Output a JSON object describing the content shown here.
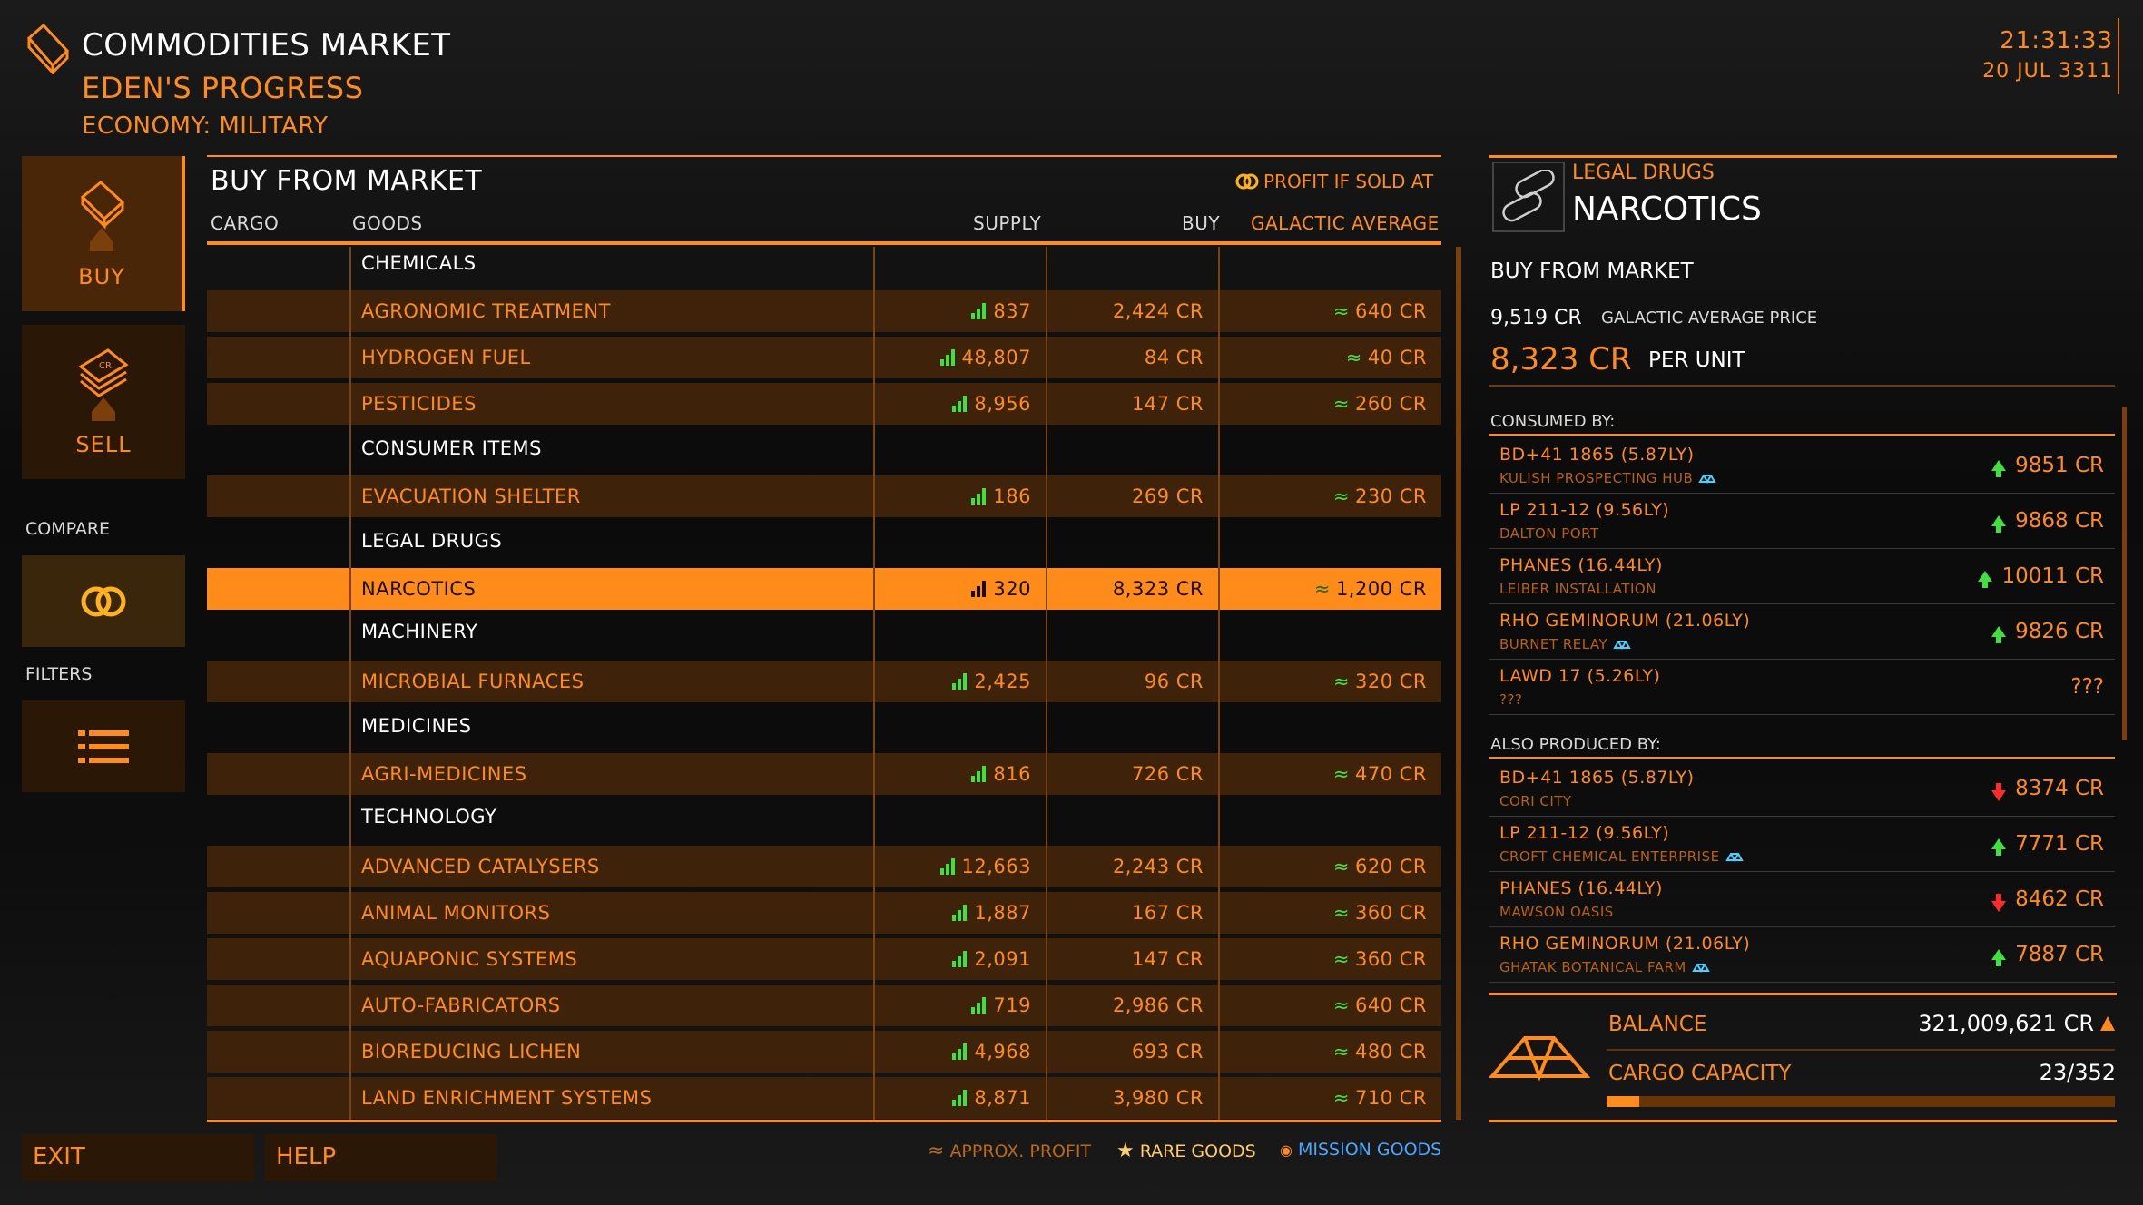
{
  "header": {
    "title": "COMMODITIES MARKET",
    "station": "EDEN'S PROGRESS",
    "economy": "ECONOMY: MILITARY",
    "time": "21:31:33",
    "date": "20 JUL 3311"
  },
  "nav": {
    "buy": "BUY",
    "sell": "SELL",
    "compare": "COMPARE",
    "filters": "FILTERS",
    "exit": "EXIT",
    "help": "HELP"
  },
  "market": {
    "title": "BUY FROM MARKET",
    "profit_label": "PROFIT IF SOLD AT",
    "columns": {
      "cargo": "CARGO",
      "goods": "GOODS",
      "supply": "SUPPLY",
      "buy": "BUY",
      "ga": "GALACTIC AVERAGE"
    },
    "rows": [
      {
        "type": "cat",
        "name": "CHEMICALS"
      },
      {
        "type": "item",
        "name": "AGRONOMIC TREATMENT",
        "supply": "837",
        "buy": "2,424 CR",
        "ga": "640 CR"
      },
      {
        "type": "item",
        "name": "HYDROGEN FUEL",
        "supply": "48,807",
        "buy": "84 CR",
        "ga": "40 CR"
      },
      {
        "type": "item",
        "name": "PESTICIDES",
        "supply": "8,956",
        "buy": "147 CR",
        "ga": "260 CR"
      },
      {
        "type": "cat",
        "name": "CONSUMER ITEMS"
      },
      {
        "type": "item",
        "name": "EVACUATION SHELTER",
        "supply": "186",
        "buy": "269 CR",
        "ga": "230 CR"
      },
      {
        "type": "cat",
        "name": "LEGAL DRUGS"
      },
      {
        "type": "sel",
        "name": "NARCOTICS",
        "supply": "320",
        "buy": "8,323 CR",
        "ga": "1,200 CR"
      },
      {
        "type": "cat",
        "name": "MACHINERY"
      },
      {
        "type": "item",
        "name": "MICROBIAL FURNACES",
        "supply": "2,425",
        "buy": "96 CR",
        "ga": "320 CR"
      },
      {
        "type": "cat",
        "name": "MEDICINES"
      },
      {
        "type": "item",
        "name": "AGRI-MEDICINES",
        "supply": "816",
        "buy": "726 CR",
        "ga": "470 CR"
      },
      {
        "type": "cat",
        "name": "TECHNOLOGY"
      },
      {
        "type": "item",
        "name": "ADVANCED CATALYSERS",
        "supply": "12,663",
        "buy": "2,243 CR",
        "ga": "620 CR"
      },
      {
        "type": "item",
        "name": "ANIMAL MONITORS",
        "supply": "1,887",
        "buy": "167 CR",
        "ga": "360 CR"
      },
      {
        "type": "item",
        "name": "AQUAPONIC SYSTEMS",
        "supply": "2,091",
        "buy": "147 CR",
        "ga": "360 CR"
      },
      {
        "type": "item",
        "name": "AUTO-FABRICATORS",
        "supply": "719",
        "buy": "2,986 CR",
        "ga": "640 CR"
      },
      {
        "type": "item",
        "name": "BIOREDUCING LICHEN",
        "supply": "4,968",
        "buy": "693 CR",
        "ga": "480 CR"
      },
      {
        "type": "item",
        "name": "LAND ENRICHMENT SYSTEMS",
        "supply": "8,871",
        "buy": "3,980 CR",
        "ga": "710 CR"
      }
    ],
    "approx_symbol": "≈"
  },
  "legend": {
    "approx": "APPROX. PROFIT",
    "rare": "RARE GOODS",
    "mission": "MISSION GOODS"
  },
  "detail": {
    "category": "LEGAL DRUGS",
    "name": "NARCOTICS",
    "subtitle": "BUY FROM MARKET",
    "ga_price": "9,519 CR",
    "ga_label": "GALACTIC AVERAGE PRICE",
    "unit_price": "8,323 CR",
    "unit_label": "PER UNIT",
    "consumed_label": "CONSUMED BY:",
    "consumed": [
      {
        "system": "BD+41 1865 (5.87LY)",
        "station": "KULISH PROSPECTING HUB",
        "icon": true,
        "trend": "up",
        "price": "9851 CR"
      },
      {
        "system": "LP 211-12 (9.56LY)",
        "station": "DALTON PORT",
        "icon": false,
        "trend": "up",
        "price": "9868 CR"
      },
      {
        "system": "PHANES (16.44LY)",
        "station": "LEIBER INSTALLATION",
        "icon": false,
        "trend": "up",
        "price": "10011 CR"
      },
      {
        "system": "RHO GEMINORUM (21.06LY)",
        "station": "BURNET RELAY",
        "icon": true,
        "trend": "up",
        "price": "9826 CR"
      },
      {
        "system": "LAWD 17 (5.26LY)",
        "station": "???",
        "icon": false,
        "trend": "none",
        "price": "???"
      }
    ],
    "produced_label": "ALSO PRODUCED BY:",
    "produced": [
      {
        "system": "BD+41 1865 (5.87LY)",
        "station": "CORI CITY",
        "icon": false,
        "trend": "down",
        "price": "8374 CR"
      },
      {
        "system": "LP 211-12 (9.56LY)",
        "station": "CROFT CHEMICAL ENTERPRISE",
        "icon": true,
        "trend": "up",
        "price": "7771 CR"
      },
      {
        "system": "PHANES (16.44LY)",
        "station": "MAWSON OASIS",
        "icon": false,
        "trend": "down",
        "price": "8462 CR"
      },
      {
        "system": "RHO GEMINORUM (21.06LY)",
        "station": "GHATAK BOTANICAL FARM",
        "icon": true,
        "trend": "up",
        "price": "7887 CR"
      }
    ]
  },
  "status": {
    "balance_label": "BALANCE",
    "balance": "321,009,621 CR",
    "cargo_label": "CARGO CAPACITY",
    "cargo": "23/352",
    "cargo_fraction": 0.065
  },
  "colors": {
    "accent": "#ff8c1a",
    "up": "#3fe03f",
    "down": "#ff2a2a",
    "mission": "#4aa8ff"
  }
}
